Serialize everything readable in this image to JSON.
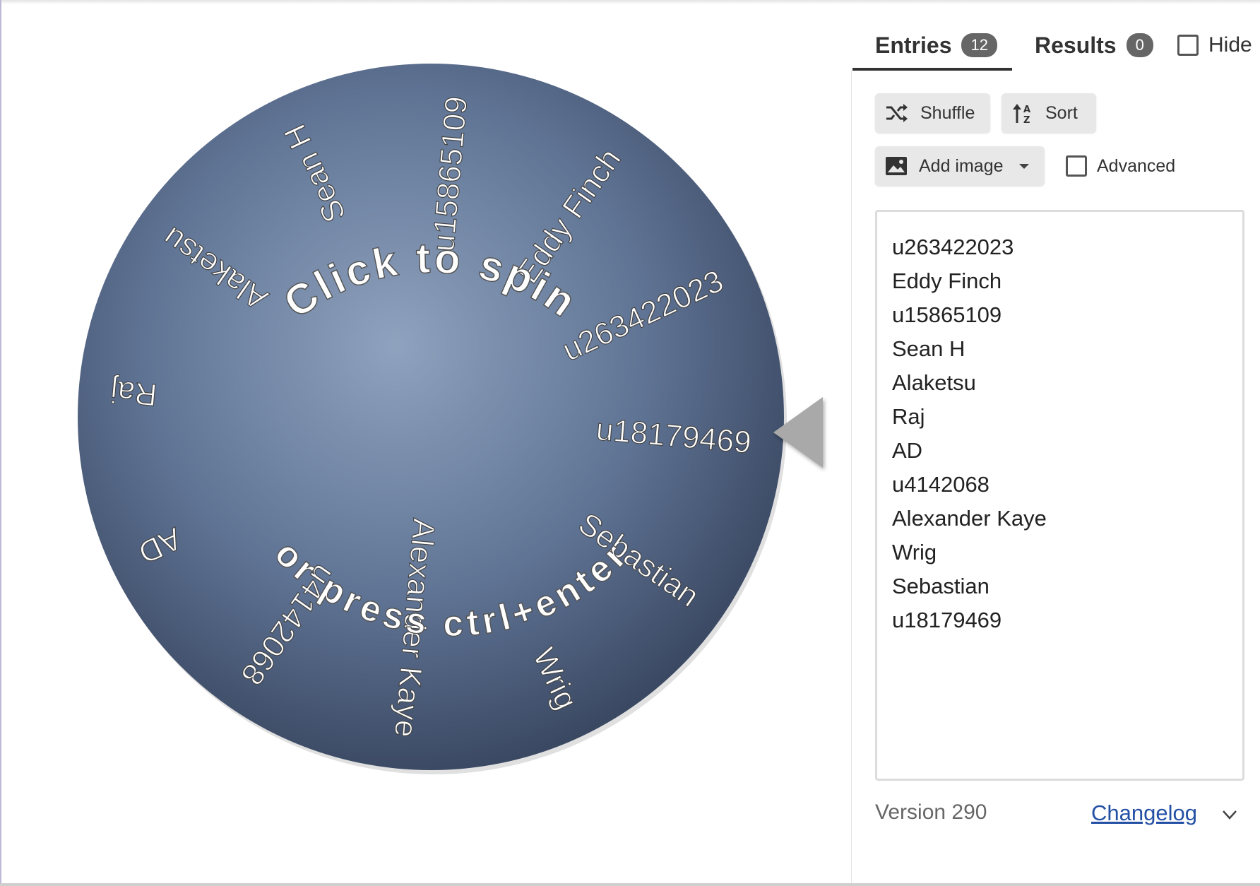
{
  "tabs": {
    "entries": {
      "label": "Entries",
      "count": "12"
    },
    "results": {
      "label": "Results",
      "count": "0"
    },
    "hide_label": "Hide"
  },
  "toolbar": {
    "shuffle_label": "Shuffle",
    "sort_label": "Sort",
    "add_image_label": "Add image",
    "advanced_label": "Advanced"
  },
  "wheel": {
    "prompt_line1": "Click to spin",
    "prompt_line2": "or press ctrl+enter",
    "segments": [
      "u263422023",
      "Eddy Finch",
      "u15865109",
      "Sean H",
      "Alaketsu",
      "Raj",
      "AD",
      "u4142068",
      "Alexander Kaye",
      "Wrig",
      "Sebastian",
      "u18179469"
    ]
  },
  "entries": [
    "u263422023",
    "Eddy Finch",
    "u15865109",
    "Sean H",
    "Alaketsu",
    "Raj",
    "AD",
    "u4142068",
    "Alexander Kaye",
    "Wrig",
    "Sebastian",
    "u18179469"
  ],
  "footer": {
    "version": "Version 290",
    "changelog_label": "Changelog"
  },
  "colors": {
    "accent": "#333333",
    "link": "#2450a4",
    "badge": "#666666"
  },
  "icons": [
    "shuffle-icon",
    "sort-icon",
    "image-icon",
    "chevron-down-icon"
  ]
}
